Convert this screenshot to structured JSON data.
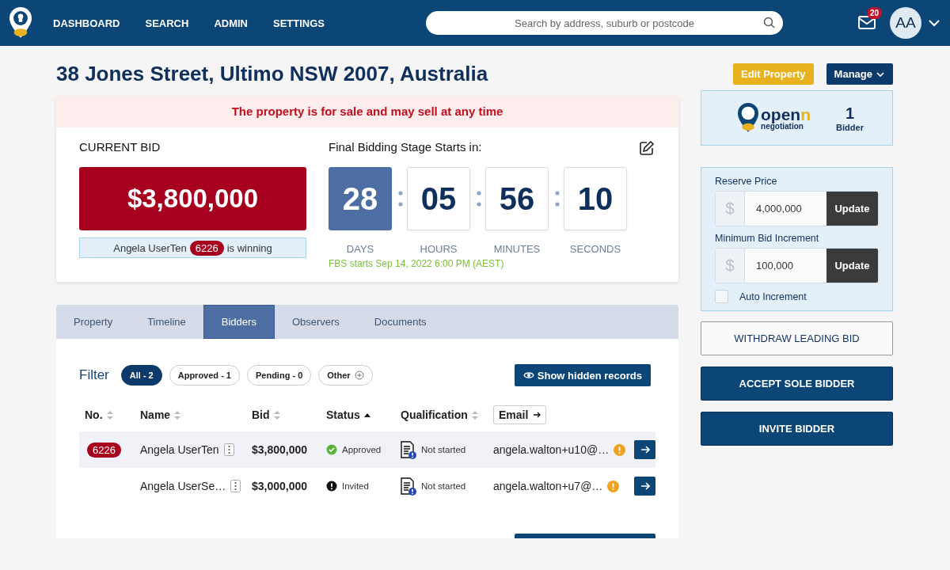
{
  "nav": {
    "items": [
      {
        "label": "DASHBOARD"
      },
      {
        "label": "SEARCH"
      },
      {
        "label": "ADMIN"
      },
      {
        "label": "SETTINGS"
      }
    ]
  },
  "search": {
    "placeholder": "Search by address, suburb or postcode"
  },
  "notifications": {
    "count": "20"
  },
  "avatar": {
    "initials": "AA"
  },
  "title": "38 Jones Street, Ultimo NSW 2007, Australia",
  "actions": [
    {
      "label": "Edit Property",
      "kind": "accent"
    },
    {
      "label": "Manage",
      "kind": "menu"
    }
  ],
  "alert": "The property is for sale and may sell at any time",
  "current_bid": {
    "heading": "CURRENT BID",
    "amount": "$3,800,000",
    "winner_name": "Angela UserTen",
    "winner_number": "6226",
    "winner_suffix": "is winning"
  },
  "countdown": {
    "heading": "Final Bidding Stage Starts in:",
    "units": [
      {
        "value": "28",
        "label": "DAYS",
        "selected": true
      },
      {
        "value": "05",
        "label": "HOURS",
        "selected": false
      },
      {
        "value": "56",
        "label": "MINUTES",
        "selected": false
      },
      {
        "value": "10",
        "label": "SECONDS",
        "selected": false
      }
    ],
    "note": "FBS starts Sep 14, 2022 6:00 PM (AEST)"
  },
  "tabs": [
    {
      "label": "Property",
      "selected": false
    },
    {
      "label": "Timeline",
      "selected": false
    },
    {
      "label": "Bidders",
      "selected": true
    },
    {
      "label": "Observers",
      "selected": false
    },
    {
      "label": "Documents",
      "selected": false
    }
  ],
  "filter": {
    "label": "Filter",
    "chips": [
      {
        "label": "All - 2",
        "selected": true,
        "kind": "plain"
      },
      {
        "label": "Approved - 1",
        "selected": false,
        "kind": "plain"
      },
      {
        "label": "Pending - 0",
        "selected": false,
        "kind": "plain"
      },
      {
        "label": "Other",
        "selected": false,
        "kind": "add"
      }
    ],
    "hidden_button": "Show hidden records"
  },
  "table": {
    "columns": [
      {
        "label": "No.",
        "kind": "sortable"
      },
      {
        "label": "Name",
        "kind": "sortable"
      },
      {
        "label": "Bid",
        "kind": "sortable"
      },
      {
        "label": "Status",
        "kind": "ascending"
      },
      {
        "label": "Qualification",
        "kind": "sortable"
      },
      {
        "label": "Email",
        "kind": "link"
      }
    ],
    "rows": [
      {
        "number": "6226",
        "name": "Angela UserTen",
        "bid": "$3,800,000",
        "status": "Approved",
        "kind": "approved",
        "qualification": "Not started",
        "email": "angela.walton+u10@…",
        "selected": true
      },
      {
        "name": "Angela UserSe…",
        "bid": "$3,000,000",
        "status": "Invited",
        "kind": "invited",
        "qualification": "Not started",
        "email": "angela.walton+u7@…",
        "selected": false
      }
    ]
  },
  "openn": {
    "brand": "openn",
    "tagline": "negotiation",
    "count": "1",
    "count_label": "Bidder"
  },
  "pricing": {
    "fields": [
      {
        "label": "Reserve Price",
        "currency": "$",
        "value": "4,000,000",
        "button": "Update"
      },
      {
        "label": "Minimum Bid Increment",
        "currency": "$",
        "value": "100,000",
        "button": "Update"
      }
    ],
    "auto_increment": {
      "label": "Auto Increment",
      "checked": false
    }
  },
  "side_buttons": [
    {
      "label": "WITHDRAW LEADING BID",
      "kind": "outline"
    },
    {
      "label": "ACCEPT SOLE BIDDER",
      "kind": "solid"
    },
    {
      "label": "INVITE BIDDER",
      "kind": "solid"
    }
  ]
}
